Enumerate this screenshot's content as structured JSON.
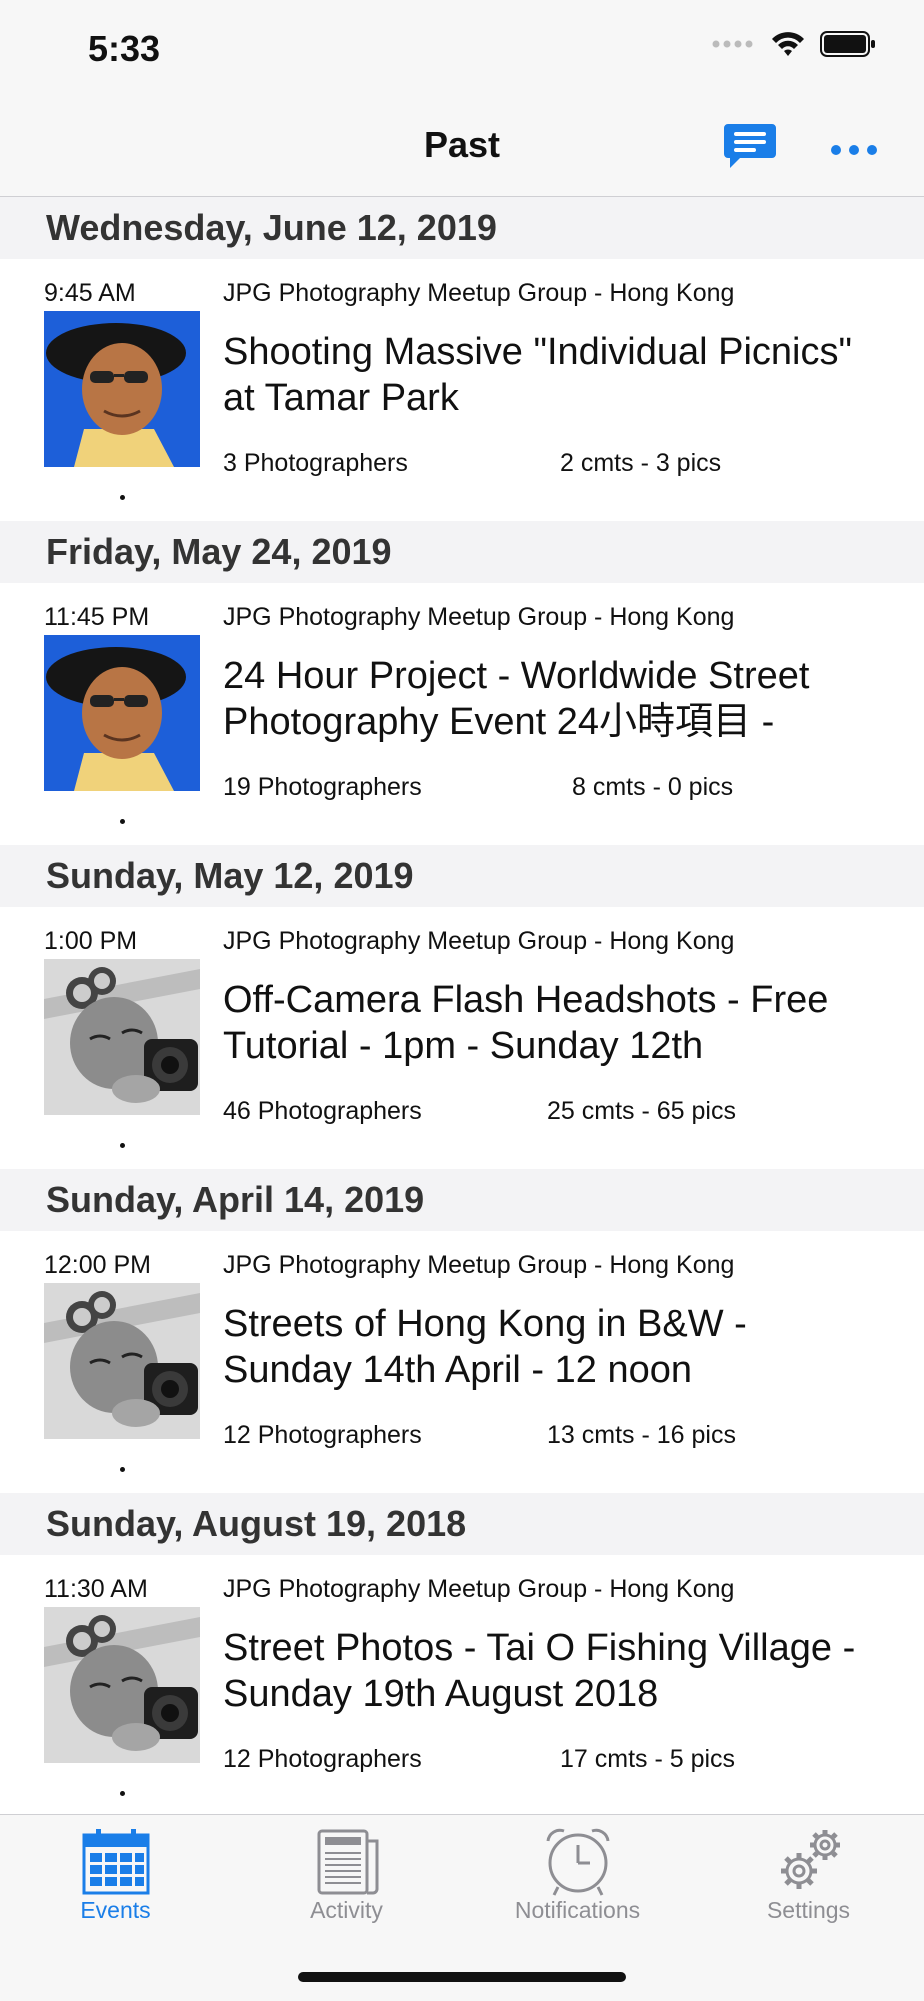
{
  "status_bar": {
    "time": "5:33"
  },
  "nav": {
    "title": "Past",
    "chat_icon": "chat-icon",
    "more_icon": "more-icon",
    "accent_color": "#1a7ee8"
  },
  "sections": [
    {
      "date": "Wednesday, June 12, 2019",
      "event": {
        "time": "9:45 AM",
        "group": "JPG Photography Meetup Group - Hong Kong",
        "title": "Shooting Massive \"Individual Picnics\" at Tamar Park",
        "photographers": "3 Photographers",
        "comments": "2 cmts - 3 pics",
        "thumb": "color-portrait"
      }
    },
    {
      "date": "Friday, May 24, 2019",
      "event": {
        "time": "11:45 PM",
        "group": "JPG Photography Meetup Group - Hong Kong",
        "title": "24 Hour Project - Worldwide Street Photography Event 24小時項目 -",
        "photographers": "19 Photographers",
        "comments": "8 cmts - 0 pics",
        "thumb": "color-portrait"
      }
    },
    {
      "date": "Sunday, May 12, 2019",
      "event": {
        "time": "1:00 PM",
        "group": "JPG Photography Meetup Group - Hong Kong",
        "title": "Off-Camera Flash Headshots - Free Tutorial - 1pm - Sunday 12th",
        "photographers": "46 Photographers",
        "comments": "25 cmts - 65 pics",
        "thumb": "bw-camera-portrait"
      }
    },
    {
      "date": "Sunday, April 14, 2019",
      "event": {
        "time": "12:00 PM",
        "group": "JPG Photography Meetup Group - Hong Kong",
        "title": "Streets of Hong Kong in B&W - Sunday 14th April - 12 noon",
        "photographers": "12 Photographers",
        "comments": "13 cmts - 16 pics",
        "thumb": "bw-camera-portrait"
      }
    },
    {
      "date": "Sunday, August 19, 2018",
      "event": {
        "time": "11:30 AM",
        "group": "JPG Photography Meetup Group - Hong Kong",
        "title": "Street Photos - Tai O Fishing Village - Sunday 19th August 2018",
        "photographers": "12 Photographers",
        "comments": "17 cmts - 5 pics",
        "thumb": "bw-camera-portrait"
      }
    }
  ],
  "tabs": [
    {
      "label": "Events",
      "icon": "calendar-icon",
      "active": true
    },
    {
      "label": "Activity",
      "icon": "newspaper-icon",
      "active": false
    },
    {
      "label": "Notifications",
      "icon": "alarm-clock-icon",
      "active": false
    },
    {
      "label": "Settings",
      "icon": "gears-icon",
      "active": false
    }
  ]
}
